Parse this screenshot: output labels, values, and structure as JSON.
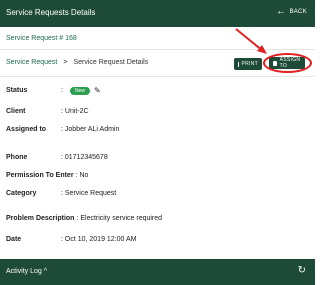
{
  "header": {
    "title": "Service Requests Details",
    "back_label": "BACK",
    "back_icon": "←"
  },
  "request": {
    "number_label": "Service Request # 168"
  },
  "breadcrumb": {
    "link": "Service Request",
    "separator": ">",
    "current": "Service Request Details"
  },
  "actions": {
    "print_label": "PRINT",
    "assign_label": "ASSIGN TO"
  },
  "details": {
    "status": {
      "label": "Status",
      "colon": ":",
      "badge": "New",
      "edit_icon": "✎"
    },
    "client": {
      "label": "Client",
      "value": ": Unit-2C"
    },
    "assigned": {
      "label": "Assigned to",
      "value": ": Jobber ALi Admin"
    },
    "phone": {
      "label": "Phone",
      "value": ": 01712345678"
    },
    "permission": {
      "label": "Permission To Enter",
      "value": ": No"
    },
    "category": {
      "label": "Category",
      "value": ": Service Request"
    },
    "problem": {
      "label": "Problem Description",
      "value": ": Electricity service required"
    },
    "date": {
      "label": "Date",
      "value": ": Oct 10, 2019 12:00 AM"
    }
  },
  "footer": {
    "title": "Activity Log ^",
    "refresh_icon": "↻"
  },
  "colors": {
    "primary": "#1e4a38",
    "accent_text": "#1e6b4f",
    "badge": "#2e9e50",
    "annotation": "#e02020"
  }
}
